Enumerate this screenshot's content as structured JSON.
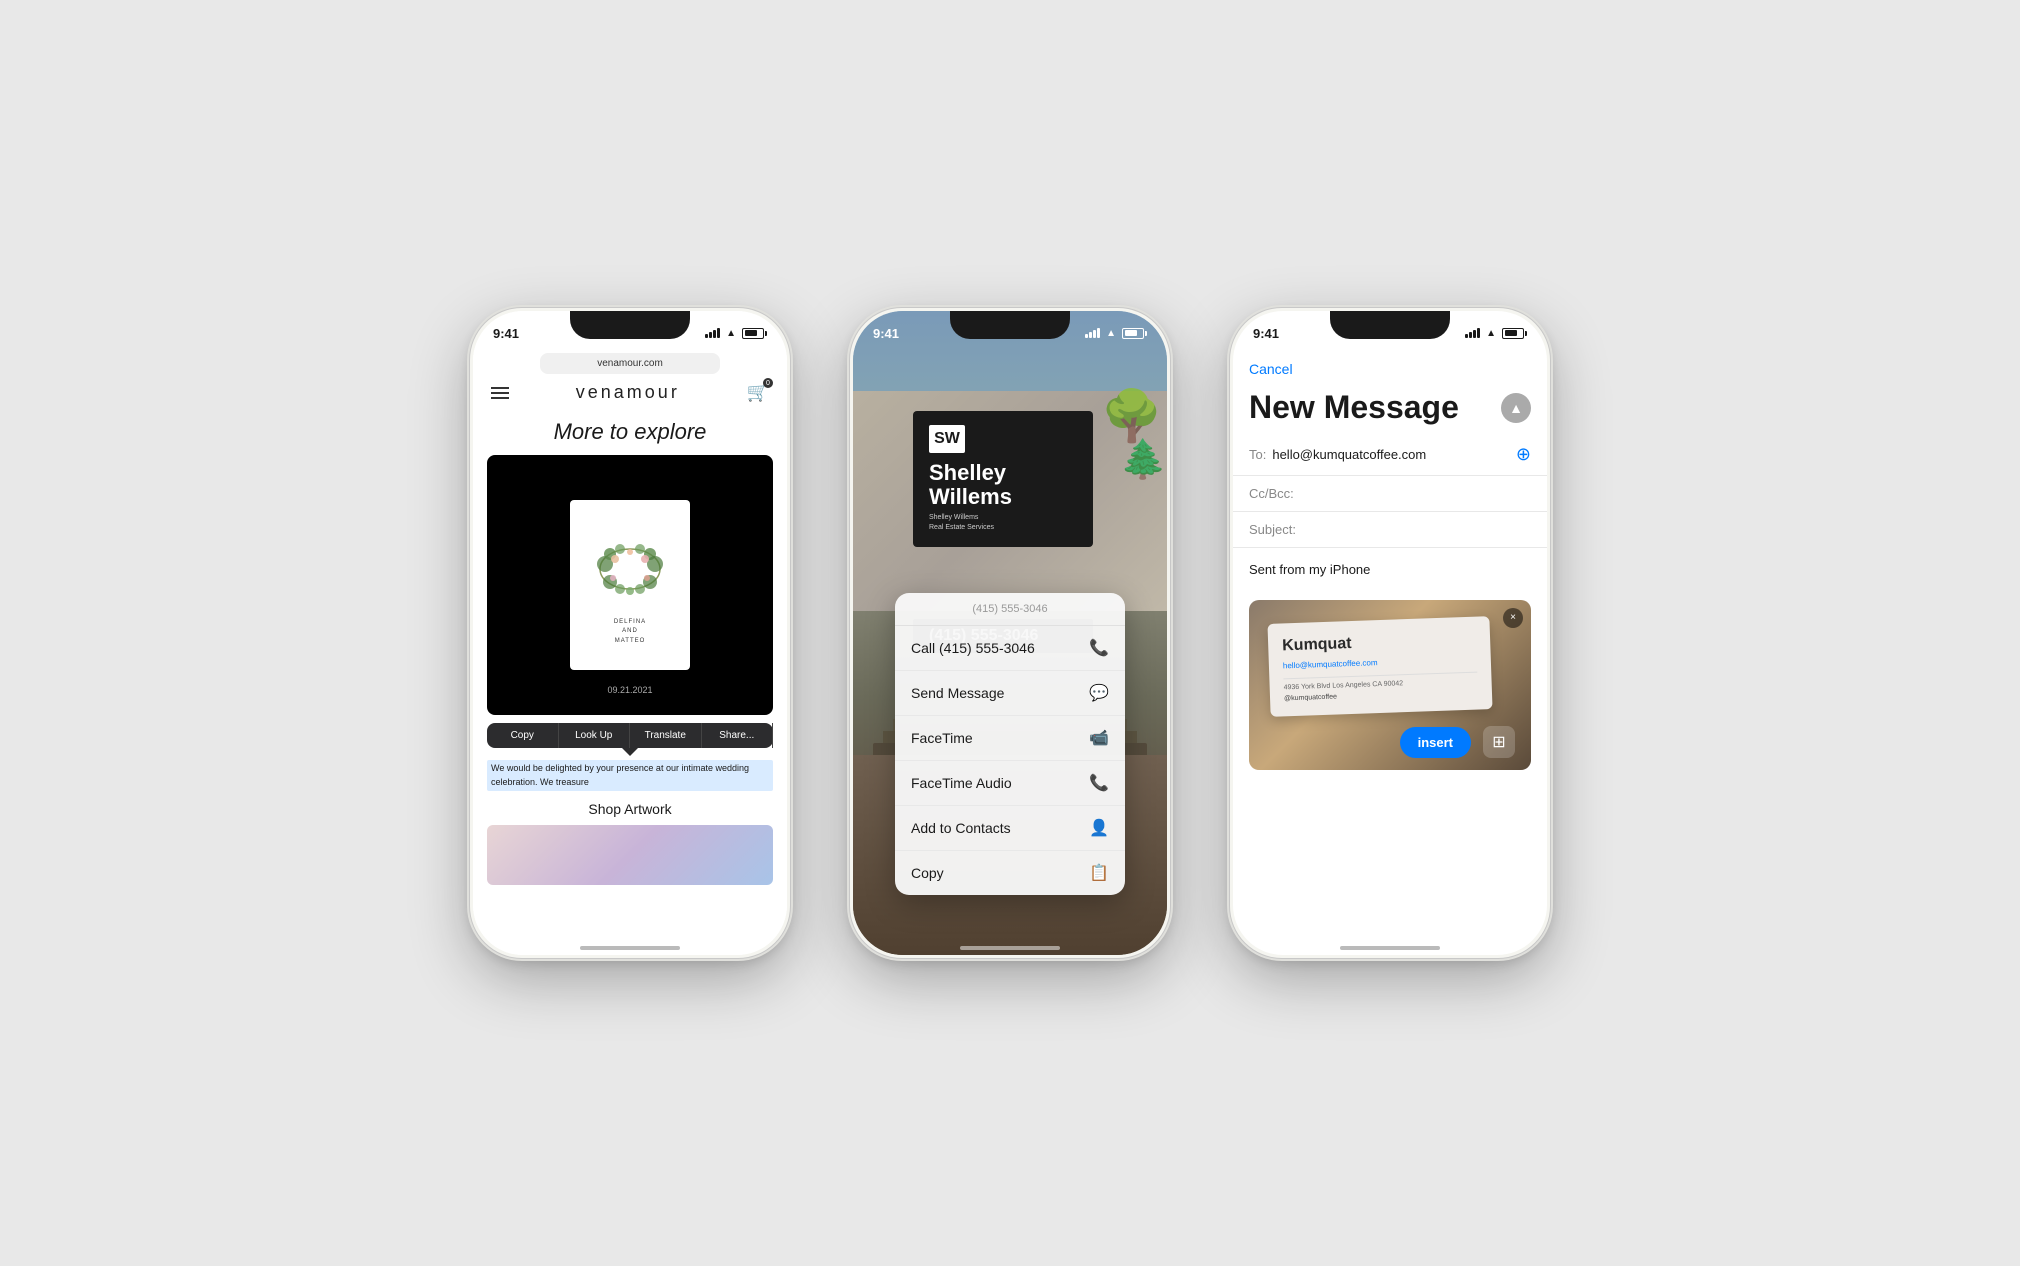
{
  "bg_color": "#e0e0e0",
  "phone1": {
    "status_time": "9:41",
    "url": "venamour.com",
    "logo": "venamour",
    "heading": "More to explore",
    "card_text_line1": "DELFINA",
    "card_text_line2": "AND",
    "card_text_line3": "MATTEO",
    "date": "09.21.2021",
    "context_copy": "Copy",
    "context_lookup": "Look Up",
    "context_translate": "Translate",
    "context_share": "Share...",
    "selected_text": "We would be delighted by your presence at our intimate wedding celebration. We treasure",
    "shop_label": "Shop Artwork"
  },
  "phone2": {
    "status_time": "9:41",
    "initials": "SW",
    "name_line1": "Shelley",
    "name_line2": "Willems",
    "sub1": "Shelley Willems",
    "sub2": "Real Estate Services",
    "phone_number": "(415) 555-3046",
    "popup_header": "(415) 555-3046",
    "menu_items": [
      {
        "label": "Call (415) 555-3046",
        "icon": "📞"
      },
      {
        "label": "Send Message",
        "icon": "💬"
      },
      {
        "label": "FaceTime",
        "icon": "📹"
      },
      {
        "label": "FaceTime Audio",
        "icon": "📞"
      },
      {
        "label": "Add to Contacts",
        "icon": "👤"
      },
      {
        "label": "Copy",
        "icon": "📋"
      }
    ]
  },
  "phone3": {
    "status_time": "9:41",
    "cancel_label": "Cancel",
    "title": "New Message",
    "to_label": "To:",
    "to_value": "hello@kumquatcoffee.com",
    "cc_label": "Cc/Bcc:",
    "subject_label": "Subject:",
    "body_text": "Sent from my iPhone",
    "card_logo": "Kumquat",
    "card_email": "hello@kumquatcoffee.com",
    "card_address": "4936 York Blvd Los Angeles CA 90042",
    "card_social": "@kumquatcoffee",
    "insert_label": "insert",
    "close_label": "×"
  }
}
